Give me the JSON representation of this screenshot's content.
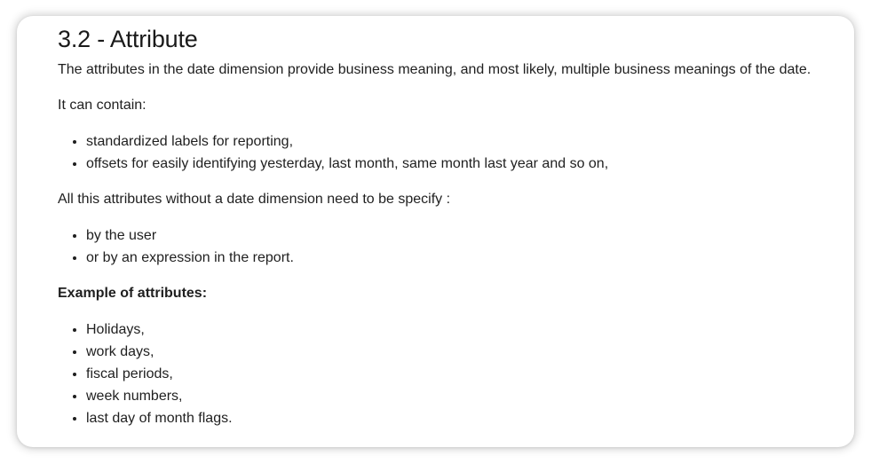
{
  "heading": "3.2 - Attribute",
  "intro": "The attributes in the date dimension provide business meaning, and most likely, multiple business meanings of the date.",
  "contain_label": "It can contain:",
  "contain_items": [
    "standardized labels for reporting,",
    "offsets for easily identifying yesterday, last month, same month last year and so on,"
  ],
  "specify_text": "All this attributes without a date dimension need to be specify :",
  "specify_items": [
    "by the user",
    "or by an expression in the report."
  ],
  "example_label": "Example of attributes:",
  "example_items": [
    "Holidays,",
    "work days,",
    "fiscal periods,",
    "week numbers,",
    "last day of month flags."
  ]
}
